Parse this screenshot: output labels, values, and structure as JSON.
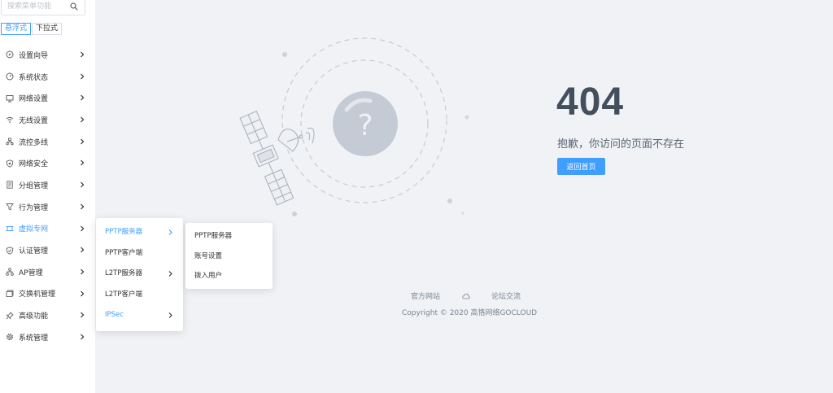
{
  "search": {
    "placeholder": "搜索菜单功能"
  },
  "modes": [
    {
      "label": "悬浮式",
      "active": true
    },
    {
      "label": "下拉式",
      "active": false
    }
  ],
  "menu": [
    {
      "label": "设置向导",
      "icon": "compass-icon"
    },
    {
      "label": "系统状态",
      "icon": "dashboard-icon"
    },
    {
      "label": "网络设置",
      "icon": "monitor-icon"
    },
    {
      "label": "无线设置",
      "icon": "wifi-icon"
    },
    {
      "label": "流控多线",
      "icon": "flow-icon"
    },
    {
      "label": "网络安全",
      "icon": "shield-icon"
    },
    {
      "label": "分组管理",
      "icon": "document-icon"
    },
    {
      "label": "行为管理",
      "icon": "funnel-icon"
    },
    {
      "label": "虚拟专网",
      "icon": "vpn-icon",
      "active": true
    },
    {
      "label": "认证管理",
      "icon": "verified-shield-icon"
    },
    {
      "label": "AP管理",
      "icon": "topology-icon"
    },
    {
      "label": "交换机管理",
      "icon": "switch-icon"
    },
    {
      "label": "高级功能",
      "icon": "pin-icon"
    },
    {
      "label": "系统管理",
      "icon": "gear-icon"
    }
  ],
  "submenu": [
    {
      "label": "PPTP服务器",
      "has_children": true,
      "highlight": true
    },
    {
      "label": "PPTP客户端",
      "has_children": false,
      "highlight": false
    },
    {
      "label": "L2TP服务器",
      "has_children": true,
      "highlight": false
    },
    {
      "label": "L2TP客户端",
      "has_children": false,
      "highlight": false
    },
    {
      "label": "IPSec",
      "has_children": true,
      "highlight": true
    }
  ],
  "submenu2": [
    {
      "label": "PPTP服务器"
    },
    {
      "label": "账号设置"
    },
    {
      "label": "拨入用户"
    }
  ],
  "error": {
    "code": "404",
    "message": "抱歉，你访问的页面不存在",
    "button": "返回首页",
    "illustration_symbol": "?"
  },
  "footer": {
    "link1": "官方网站",
    "link2": "论坛交流",
    "copyright": "Copyright © 2020 高恪网络GOCLOUD"
  },
  "colors": {
    "accent": "#409eff",
    "heading": "#434f5d",
    "background": "#f0f2f5"
  }
}
